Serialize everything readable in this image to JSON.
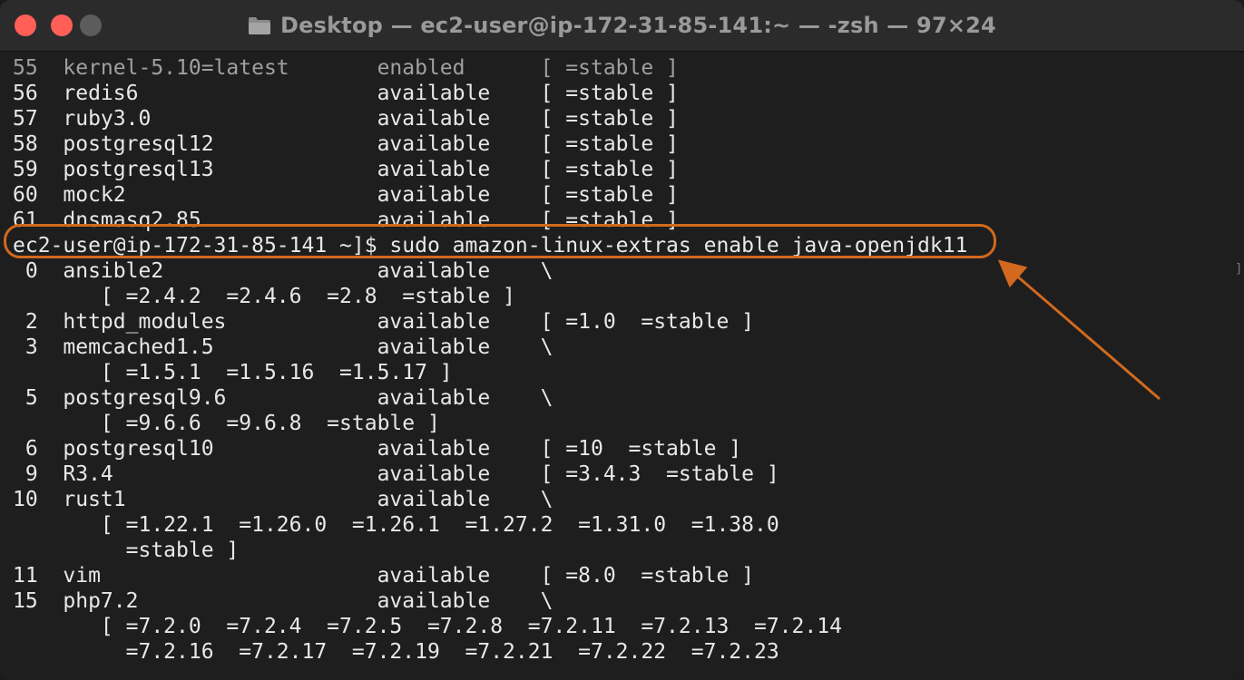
{
  "window": {
    "title": "Desktop — ec2-user@ip-172-31-85-141:~ — -zsh — 97×24",
    "accent_color": "#d2691e"
  },
  "terminal": {
    "lines": [
      "55  kernel-5.10=latest       enabled      [ =stable ]",
      "56  redis6                   available    [ =stable ]",
      "57  ruby3.0                  available    [ =stable ]",
      "58  postgresql12             available    [ =stable ]",
      "59  postgresql13             available    [ =stable ]",
      "60  mock2                    available    [ =stable ]",
      "61  dnsmasq2.85              available    [ =stable ]",
      "ec2-user@ip-172-31-85-141 ~]$ sudo amazon-linux-extras enable java-openjdk11",
      " 0  ansible2                 available    \\",
      "       [ =2.4.2  =2.4.6  =2.8  =stable ]",
      " 2  httpd_modules            available    [ =1.0  =stable ]",
      " 3  memcached1.5             available    \\",
      "       [ =1.5.1  =1.5.16  =1.5.17 ]",
      " 5  postgresql9.6            available    \\",
      "       [ =9.6.6  =9.6.8  =stable ]",
      " 6  postgresql10             available    [ =10  =stable ]",
      " 9  R3.4                     available    [ =3.4.3  =stable ]",
      "10  rust1                    available    \\",
      "       [ =1.22.1  =1.26.0  =1.26.1  =1.27.2  =1.31.0  =1.38.0",
      "         =stable ]",
      "11  vim                      available    [ =8.0  =stable ]",
      "15  php7.2                   available    \\",
      "       [ =7.2.0  =7.2.4  =7.2.5  =7.2.8  =7.2.11  =7.2.13  =7.2.14",
      "         =7.2.16  =7.2.17  =7.2.19  =7.2.21  =7.2.22  =7.2.23"
    ],
    "scroll_marker": "]"
  }
}
